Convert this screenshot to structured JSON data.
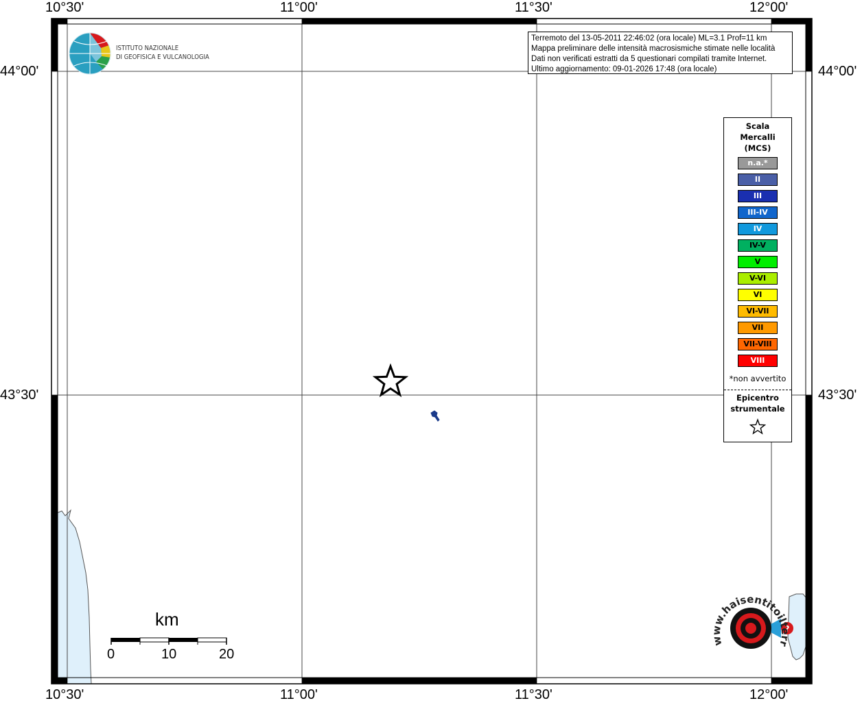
{
  "map": {
    "lon_labels": [
      "10°30'",
      "11°00'",
      "11°30'",
      "12°00'"
    ],
    "lat_labels": [
      "44°00'",
      "43°30'"
    ]
  },
  "logo": {
    "line1": "ISTITUTO NAZIONALE",
    "line2": "DI GEOFISICA E VULCANOLOGIA"
  },
  "info": {
    "line1": "Terremoto del 13-05-2011 22:46:02 (ora locale) ML=3.1 Prof=11 km",
    "line2": "Mappa preliminare delle intensità macrosismiche stimate nelle località",
    "line3": "Dati non verificati estratti da 5 questionari compilati tramite Internet.",
    "line4": "Ultimo aggiornamento: 09-01-2026 17:48 (ora locale)"
  },
  "legend": {
    "title_line1": "Scala",
    "title_line2": "Mercalli",
    "title_line3": "(MCS)",
    "items": [
      {
        "label": "n.a.*",
        "color": "#999999"
      },
      {
        "label": "II",
        "color": "#4a5fa7"
      },
      {
        "label": "III",
        "color": "#1a2fb0"
      },
      {
        "label": "III-IV",
        "color": "#1166cc"
      },
      {
        "label": "IV",
        "color": "#1199dd"
      },
      {
        "label": "IV-V",
        "color": "#00b060"
      },
      {
        "label": "V",
        "color": "#00ee00"
      },
      {
        "label": "V-VI",
        "color": "#aaee00"
      },
      {
        "label": "VI",
        "color": "#ffff00"
      },
      {
        "label": "VI-VII",
        "color": "#ffbb00"
      },
      {
        "label": "VII",
        "color": "#ff9900"
      },
      {
        "label": "VII-VIII",
        "color": "#ff6600"
      },
      {
        "label": "VIII",
        "color": "#ff0000"
      }
    ],
    "note": "*non avvertito",
    "epicenter_line1": "Epicentro",
    "epicenter_line2": "strumentale"
  },
  "scalebar": {
    "unit": "km",
    "ticks": [
      "0",
      "10",
      "20"
    ]
  },
  "brand": {
    "text": "www.haisentitoilterremoto.it"
  },
  "colors": {
    "sea": "#dff0fb",
    "coast": "#555555",
    "lake": "#1a3a8a",
    "logo_red": "#d7191c"
  }
}
